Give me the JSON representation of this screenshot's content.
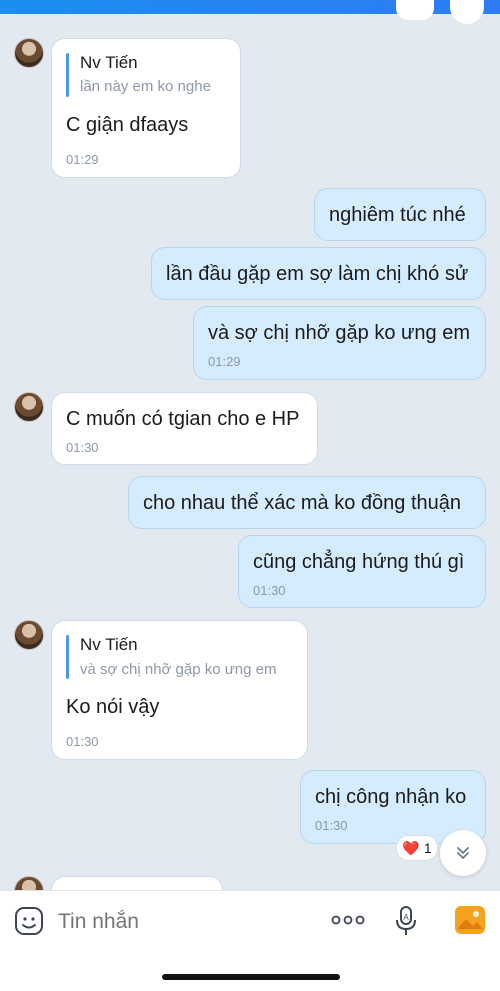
{
  "messages": [
    {
      "quote_name": "Nv Tiến",
      "quote_text": "lần này em ko nghe",
      "text": "C giận dfaays",
      "time": "01:29"
    },
    {
      "text": "nghiêm túc nhé"
    },
    {
      "text": "lần đầu gặp em sợ làm chị khó sử"
    },
    {
      "text": "và sợ chị nhỡ gặp ko ưng em",
      "time": "01:29"
    },
    {
      "text": "C muốn có tgian cho e HP",
      "time": "01:30"
    },
    {
      "text": "cho nhau thể xác mà ko đồng thuận"
    },
    {
      "text": "cũng chẳng hứng thú gì",
      "time": "01:30"
    },
    {
      "quote_name": "Nv Tiến",
      "quote_text": "và sợ chị nhỡ gặp ko ưng em",
      "text": "Ko nói vậy",
      "time": "01:30"
    },
    {
      "text": "chị công nhận ko",
      "time": "01:30"
    }
  ],
  "reaction": {
    "emoji": "❤️",
    "count": "1"
  },
  "composer": {
    "placeholder": "Tin nhắn"
  },
  "icons": {
    "sticker": "sticker-icon",
    "more": "more-icon",
    "voice": "microphone-icon",
    "image": "image-icon",
    "scroll": "chevron-double-down-icon"
  },
  "colors": {
    "outgoing": "#d5ecfe",
    "incoming": "#ffffff",
    "background": "#e2e9f1",
    "accent": "#4a9be0"
  }
}
